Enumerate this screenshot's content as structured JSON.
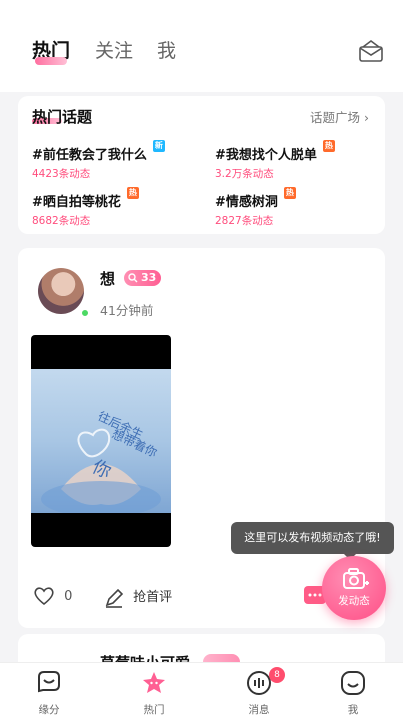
{
  "header": {
    "tabs": [
      {
        "label": "热门",
        "active": true
      },
      {
        "label": "关注",
        "active": false
      },
      {
        "label": "我",
        "active": false
      }
    ],
    "mail_icon": "mail-icon"
  },
  "topics": {
    "title": "热门话题",
    "more_label": "话题广场",
    "items": [
      {
        "name": "#前任教会了我什么",
        "count": "4423条动态",
        "badge": "新",
        "badge_color": "#1fb8ff"
      },
      {
        "name": "#我想找个人脱单",
        "count": "3.2万条动态",
        "badge": "热",
        "badge_color": "#ff6a2b"
      },
      {
        "name": "#晒自拍等桃花",
        "count": "8682条动态",
        "badge": "热",
        "badge_color": "#ff6a2b"
      },
      {
        "name": "#情感树洞",
        "count": "2827条动态",
        "badge": "热",
        "badge_color": "#ff6a2b"
      }
    ]
  },
  "post": {
    "username": "想",
    "level": "33",
    "time": "41分钟前",
    "video_text": [
      "往后余生",
      "想带着你",
      "你"
    ],
    "like_count": "0",
    "comment_label": "抢首评"
  },
  "tooltip": "这里可以发布视频动态了哦!",
  "fab_label": "发动态",
  "next_post": {
    "username": "草莓味小可爱"
  },
  "bottom_nav": [
    {
      "label": "缘分",
      "icon": "heart-chat-icon"
    },
    {
      "label": "热门",
      "icon": "star-icon",
      "active": true
    },
    {
      "label": "消息",
      "icon": "message-icon",
      "badge": "8"
    },
    {
      "label": "我",
      "icon": "profile-icon"
    }
  ],
  "colors": {
    "accent": "#ff4d7d",
    "brand_pink": "#ff5f93"
  }
}
